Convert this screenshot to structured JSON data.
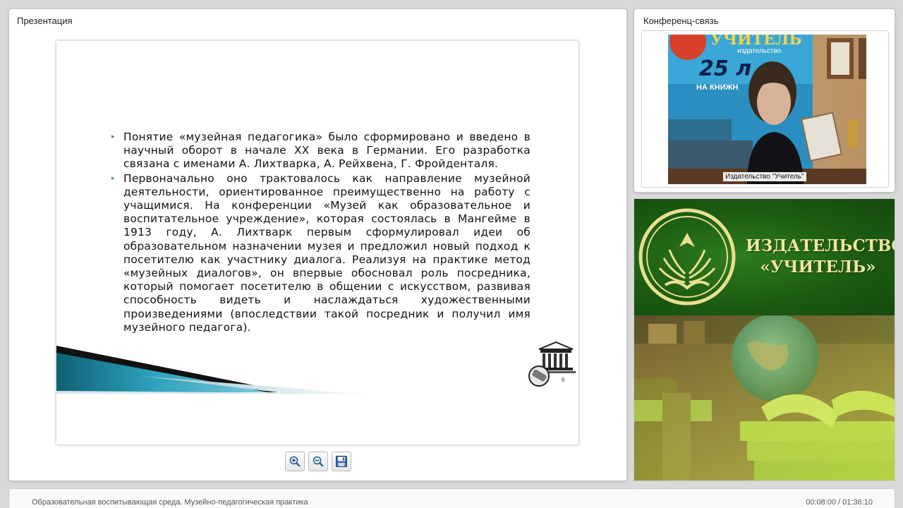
{
  "presentation": {
    "title": "Презентация",
    "slide": {
      "bullets": [
        "Понятие «музейная педагогика» было сформировано и введено в научный оборот в начале XX века в Германии. Его разработка связана с именами А. Лихтварка, А. Рейхвена, Г. Фройденталя.",
        "Первоначально оно трактовалось как направление музейной деятельности, ориентированное преимущественно на работу с учащимися. На конференции «Музей как образовательное и воспитательное учреждение», которая состоялась в Мангейме в 1913 году, А. Лихтварк первым сформулировал идеи об образовательном назначении музея и предложил новый подход к посетителю как участнику диалога. Реализуя на практике метод «музейных диалогов», он впервые обосновал роль посредника, который помогает посетителю в общении с искусством, развивая способность видеть и наслаждаться художественными произведениями (впоследствии такой посредник и получил имя музейного педагога)."
      ],
      "logo_icon": "museum-building-icon",
      "page_number": "6"
    },
    "toolbar": {
      "zoom_in_icon": "zoom-in-icon",
      "zoom_out_icon": "zoom-out-icon",
      "save_icon": "save-icon"
    }
  },
  "conference": {
    "title": "Конференц-связь",
    "video_caption": "Издательство \"Учитель\"",
    "banner_text": [
      "УЧИТЕЛЬ",
      "издательство",
      "25 л",
      "НА КНИЖН"
    ]
  },
  "brand": {
    "name_line1": "ИЗДАТЕЛЬСТВО",
    "name_line2": "«УЧИТЕЛЬ»",
    "logo_icon": "open-book-emblem-icon"
  },
  "status": {
    "lecture_title": "Образовательная воспитывающая среда. Музейно-педагогическая практика",
    "time": "00:08:00 / 01:36:10"
  },
  "colors": {
    "brand_green": "#1c5c12",
    "brand_gold": "#f1e6a1",
    "swoosh_teal": "#1c7f96",
    "page_bg": "#d9d9d9"
  }
}
